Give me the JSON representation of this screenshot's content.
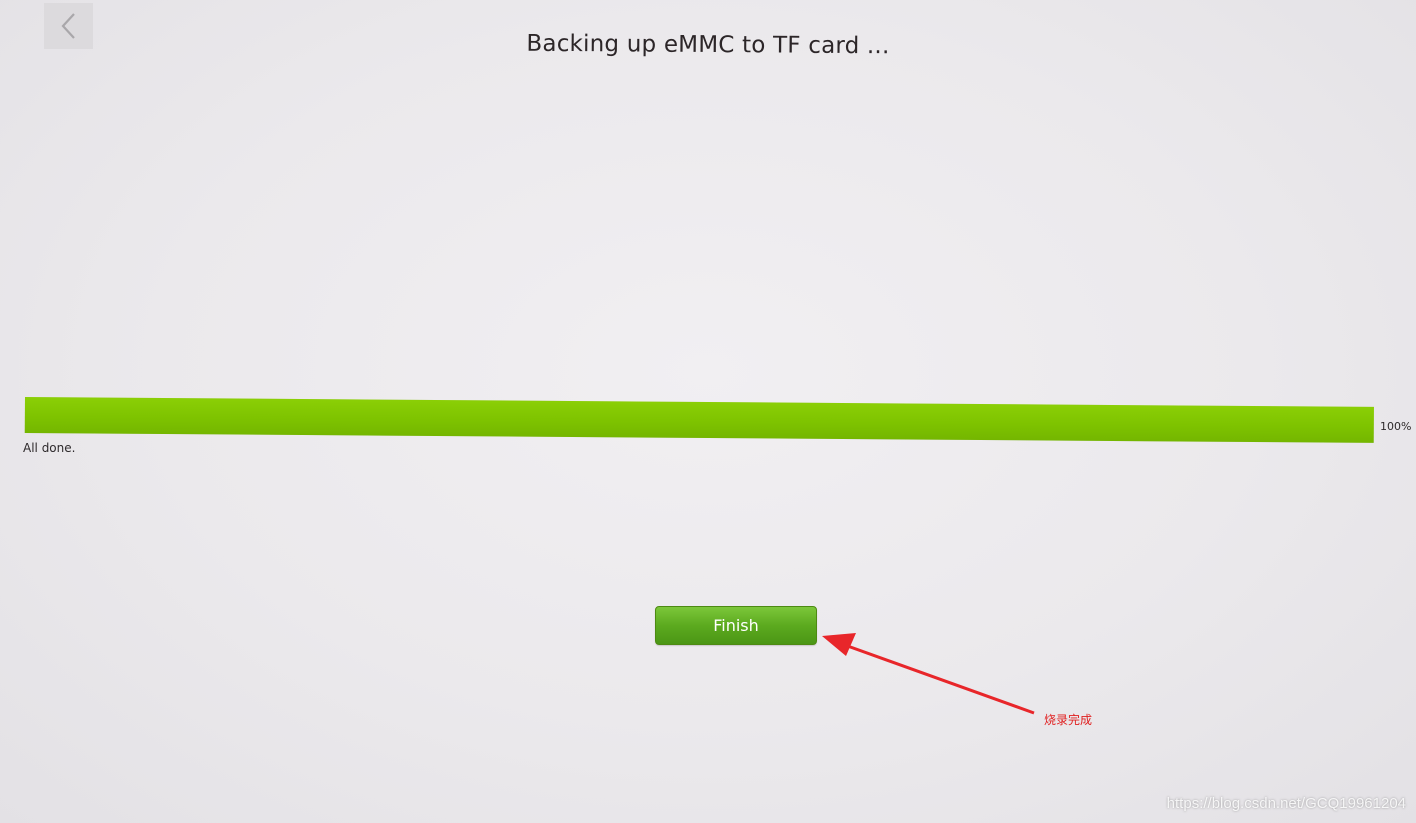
{
  "screen": {
    "title": "Backing up eMMC to TF card ..."
  },
  "navigation": {
    "back_icon": "chevron-left-icon"
  },
  "progress": {
    "percent": 100,
    "percent_label": "100%",
    "status": "All done."
  },
  "actions": {
    "finish_label": "Finish"
  },
  "annotation": {
    "label": "烧录完成",
    "color": "#e02020"
  },
  "watermark": {
    "text": "https://blog.csdn.net/GCQ19961204"
  },
  "colors": {
    "progress_fill": "#7ec300",
    "button_green": "#5caa1f",
    "background": "#ebe9ec"
  }
}
